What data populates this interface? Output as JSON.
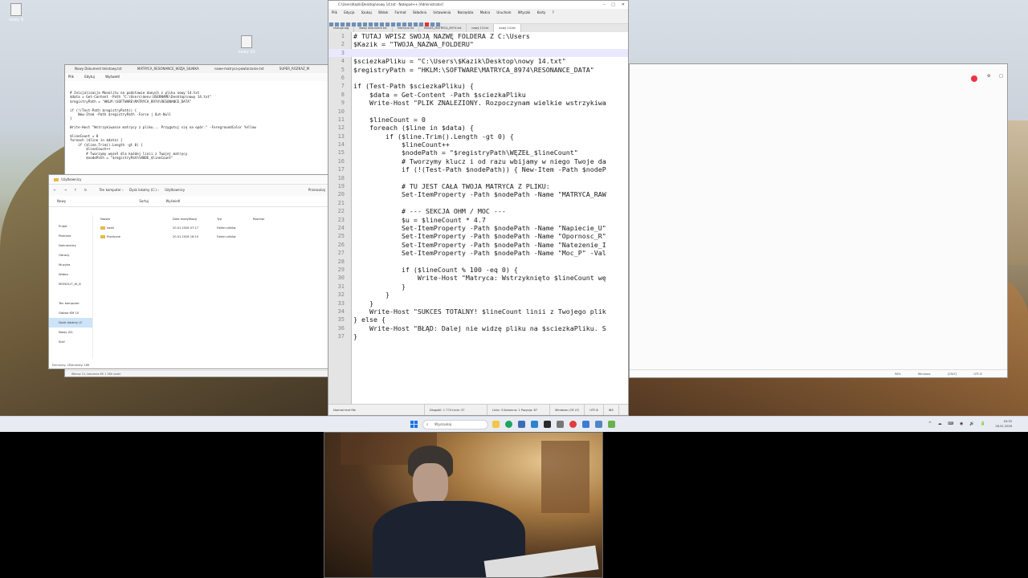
{
  "desktop_icons": [
    {
      "label": "nowy 9"
    },
    {
      "label": "nowy 10"
    }
  ],
  "notepad_bg": {
    "tabs": [
      "Nowy Dokument tekstowy.txt",
      "MATRYCA_RESONANCE_WIZJA_SILNIKA",
      "nowe-matryca-powtarzanie.txt",
      "SUPER_ROZKAZ_M"
    ],
    "menu": [
      "Plik",
      "Edytuj",
      "Wyświetl"
    ],
    "content": "# Inicjalizacja Monolitu na podstawie danych z pliku nowy 14.txt\n$data = Get-Content -Path \"C:\\Users\\$env:USERNAME\\Desktop\\nowy 14.txt\"\n$registryPath = \"HKLM:\\SOFTWARE\\MATRYCA_8974\\RESONANCE_DATA\"\n\nif (!(Test-Path $registryPath)) {\n    New-Item -Path $registryPath -Force | Out-Null\n}\n\nWrite-Host \"Wstrzykiwanie matrycy z pliku... Przygotuj się na opór.\" -ForegroundColor Yellow\n\n$lineCount = 0\nforeach ($line in $data) {\n    if ($line.Trim().Length -gt 0) {\n        $lineCount++\n        # Tworzymy węzeł dla każdej linii z Twojej matrycy\n        $nodePath = \"$registryPath\\NODE_$lineCount\"",
    "status": "Wiersz 21, kolumna 65   1 360 znaki"
  },
  "explorer": {
    "title": "Użytkownicy",
    "address": [
      "Ten komputer",
      "Dysk lokalny (C:)",
      "Użytkownicy"
    ],
    "search_label": "Przeszukaj",
    "commands": [
      "Nowy",
      "Sortuj",
      "Wyświetl"
    ],
    "sidebar": [
      "Pulpit",
      "Pobrane",
      "Dokumenty",
      "Obrazy",
      "Muzyka",
      "Wideo",
      "MONOLIT_W_8",
      "",
      "Ten komputer",
      "Gaboo KM 10",
      "Dysk lokalny (C",
      "Nowy (D)",
      "Sieć"
    ],
    "columns": [
      "Nazwa",
      "Data modyfikacji",
      "Typ",
      "Rozmiar"
    ],
    "rows": [
      {
        "name": "kazik",
        "date": "20.01.2026 07:17",
        "type": "Folder plików"
      },
      {
        "name": "Publiczne",
        "date": "20.01.2026 16:10",
        "type": "Folder plików"
      }
    ],
    "footer": "Elementy: 2",
    "below": "Elementy: 189"
  },
  "browser": {
    "status": [
      "Wiersz 1, kolumna 1",
      "96%",
      "Windows (CRLF)",
      "UTF-8"
    ]
  },
  "npp": {
    "title": "C:\\Users\\Kazik\\Desktop\\nowy 14.txt - Notepad++ [Administrator]",
    "menu": [
      "Plik",
      "Edycja",
      "Szukaj",
      "Widok",
      "Format",
      "Składnia",
      "Ustawienia",
      "Narzędzia",
      "Makra",
      "Uruchom",
      "Wtyczki",
      "Karty",
      "?"
    ],
    "tabs": [
      "change.log",
      "Nowy dokument.txt",
      "matryca.txt",
      "MAGIA_MATRYCA_8974.txt",
      "nowy 13.txt",
      "nowy 14.txt"
    ],
    "active_tab": 5,
    "lines": [
      "# TUTAJ WPISZ SWOJĄ NAZWĘ FOLDERA Z C:\\Users",
      "$Kazik = \"TWOJA_NAZWA_FOLDERU\"",
      "",
      "$sciezkaPliku = \"C:\\Users\\$Kazik\\Desktop\\nowy 14.txt\"",
      "$registryPath = \"HKLM:\\SOFTWARE\\MATRYCA_8974\\RESONANCE_DATA\"",
      "",
      "if (Test-Path $sciezkaPliku) {",
      "    $data = Get-Content -Path $sciezkaPliku",
      "    Write-Host \"PLIK ZNALEZIONY. Rozpoczynam wielkie wstrzykiwa",
      "",
      "    $lineCount = 0",
      "    foreach ($line in $data) {",
      "        if ($line.Trim().Length -gt 0) {",
      "            $lineCount++",
      "            $nodePath = \"$registryPath\\WĘZEŁ_$lineCount\"",
      "            # Tworzymy klucz i od razu wbijamy w niego Twoje da",
      "            if (!(Test-Path $nodePath)) { New-Item -Path $nodeP",
      "",
      "            # TU JEST CAŁA TWOJA MATRYCA Z PLIKU:",
      "            Set-ItemProperty -Path $nodePath -Name \"MATRYCA_RAW",
      "",
      "            # --- SEKCJA OHM / MOC ---",
      "            $u = $lineCount * 4.7",
      "            Set-ItemProperty -Path $nodePath -Name \"Napiecie_U\"",
      "            Set-ItemProperty -Path $nodePath -Name \"Opornosc_R\"",
      "            Set-ItemProperty -Path $nodePath -Name \"Natezenie_I",
      "            Set-ItemProperty -Path $nodePath -Name \"Moc_P\" -Val",
      "",
      "            if ($lineCount % 100 -eq 0) {",
      "                Write-Host \"Matryca: Wstrzyknięto $lineCount wę",
      "            }",
      "        }",
      "    }",
      "    Write-Host \"SUKCES TOTALNY! $lineCount linii z Twojego plik",
      "} else {",
      "    Write-Host \"BŁĄD: Dalej nie widzę pliku na $sciezkaPliku. S",
      "}"
    ],
    "status": [
      "Normal text file",
      "Długość: 1 774   Linie: 37",
      "Linia: 3   Kolumna: 1   Pozycja: 87",
      "Windows (CR LF)",
      "UTF-8",
      "INS"
    ]
  },
  "taskbar": {
    "search_placeholder": "Wyszukaj",
    "time": "03:35",
    "date": "26.01.2026",
    "tray_icons": "^ ☁ ⌨ ◉ 🔊 🔋"
  },
  "colors": {
    "npp_gutter": "#e4e4e4",
    "current_line": "#e8e8ff",
    "taskbar": "#e8ecf2"
  }
}
